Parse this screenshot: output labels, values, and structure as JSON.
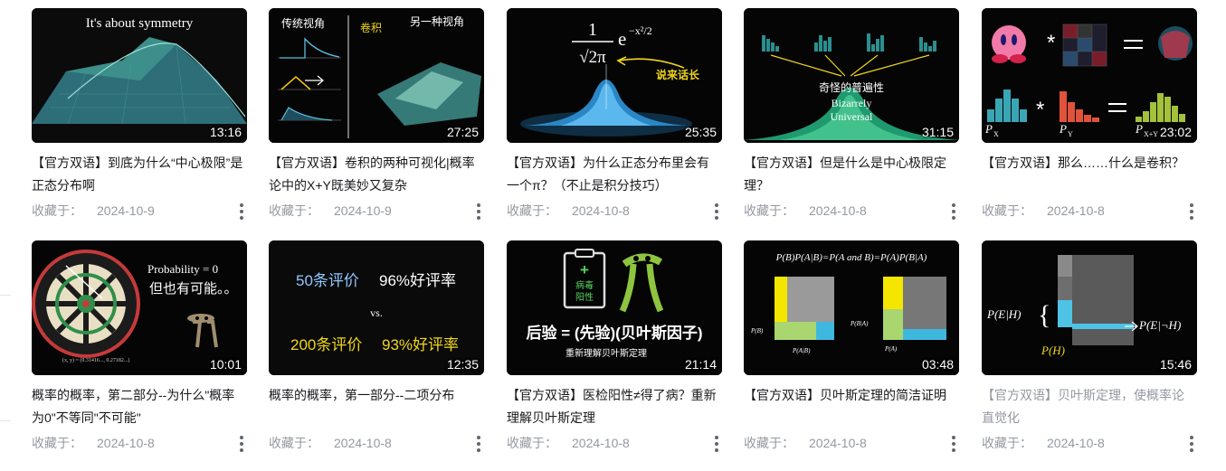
{
  "saved_prefix": "收藏于：",
  "videos": [
    {
      "title": "【官方双语】到底为什么“中心极限”是正态分布啊",
      "duration": "13:16",
      "date": "2024-10-9",
      "thumb_text": [
        "It's about symmetry"
      ]
    },
    {
      "title": "【官方双语】卷积的两种可视化|概率论中的X+Y既美妙又复杂",
      "duration": "27:25",
      "date": "2024-10-9",
      "thumb_text": [
        "传统视角",
        "卷积",
        "另一种视角"
      ]
    },
    {
      "title": "【官方双语】为什么正态分布里会有一个π？（不止是积分技巧）",
      "duration": "25:35",
      "date": "2024-10-8",
      "thumb_text": [
        "1",
        "√2π",
        "e",
        "−x²/2",
        "说来话长"
      ]
    },
    {
      "title": "【官方双语】但是什么是中心极限定理？",
      "duration": "31:15",
      "date": "2024-10-8",
      "thumb_text": [
        "奇怪的普遍性",
        "Bizarrely",
        "Universal"
      ]
    },
    {
      "title": "【官方双语】那么……什么是卷积？",
      "duration": "23:02",
      "date": "2024-10-8",
      "thumb_text": [
        "P",
        "X",
        "P",
        "Y",
        "P",
        "X+Y"
      ]
    },
    {
      "title": "概率的概率，第二部分--为什么\"概率为0\"不等同\"不可能\"",
      "duration": "10:01",
      "date": "2024-10-8",
      "thumb_text": [
        "Probability = 0",
        "但也有可能。。",
        "(x, y) = (0.31416..., 0.27182...)"
      ]
    },
    {
      "title": "概率的概率，第一部分--二项分布",
      "duration": "12:35",
      "date": "2024-10-8",
      "thumb_text": [
        "50条评价",
        "96%好评率",
        "vs.",
        "200条评价",
        "93%好评率"
      ]
    },
    {
      "title": "【官方双语】医检阳性≠得了病？重新理解贝叶斯定理",
      "duration": "21:14",
      "date": "2024-10-8",
      "thumb_text": [
        "+",
        "病毒",
        "阳性",
        "后验 = (先验)(贝叶斯因子)",
        "重新理解贝叶斯定理"
      ]
    },
    {
      "title": "【官方双语】贝叶斯定理的简洁证明",
      "duration": "03:48",
      "date": "2024-10-8",
      "thumb_text": [
        "P(B)P(A|B)=P(A and B)=P(A)P(B|A)",
        "P(B)",
        "P(A|B)",
        "P(B|A)",
        "P(A)"
      ]
    },
    {
      "title": "【官方双语】贝叶斯定理，使概率论直觉化",
      "duration": "15:46",
      "date": "2024-10-8",
      "faded": true,
      "thumb_text": [
        "P(E|H)",
        "P(E|¬H)",
        "P(H)"
      ]
    }
  ]
}
